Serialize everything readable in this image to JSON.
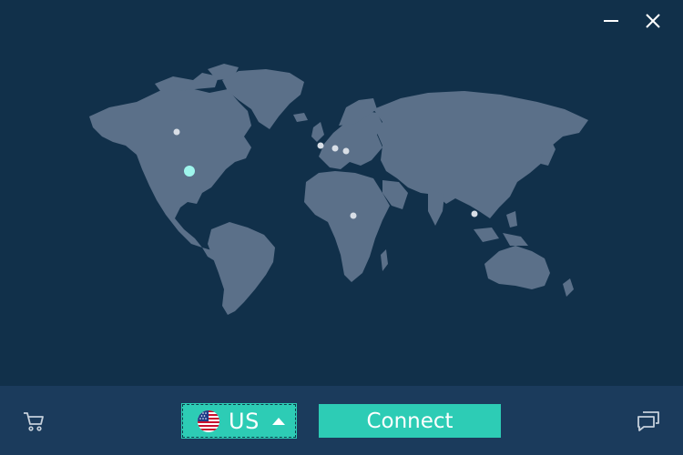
{
  "window": {
    "minimize_icon": "minimize-icon",
    "close_icon": "close-icon"
  },
  "map": {
    "land_color": "#5b7089",
    "background_color": "#11304a",
    "server_dot_color": "#d8dee6",
    "selected_dot_color": "#9ef5ec",
    "locations": [
      {
        "region": "north-america-west",
        "selected": false
      },
      {
        "region": "north-america-east",
        "selected": true
      },
      {
        "region": "europe-west",
        "selected": false
      },
      {
        "region": "europe-central",
        "selected": false
      },
      {
        "region": "europe-east",
        "selected": false
      },
      {
        "region": "africa",
        "selected": false
      },
      {
        "region": "southeast-asia",
        "selected": false
      }
    ]
  },
  "bottom": {
    "cart_icon": "cart-icon",
    "chat_icon": "chat-icon",
    "country": {
      "code": "US",
      "flag": "us-flag-icon"
    },
    "connect_label": "Connect",
    "accent_color": "#2dccb5"
  }
}
